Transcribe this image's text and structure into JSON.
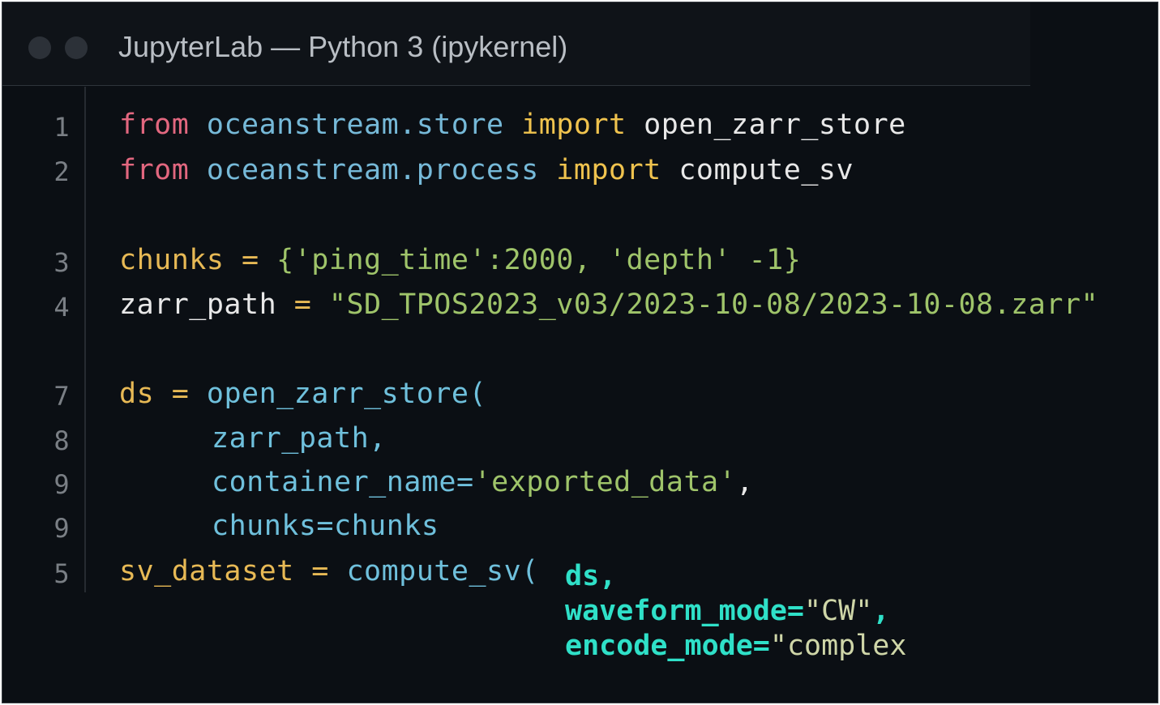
{
  "window": {
    "title": "JupyterLab — Python 3 (ipykernel)"
  },
  "lines": [
    {
      "num": "1",
      "tokens": [
        "from",
        " oceanstream.store",
        " import",
        " open_zarr_store"
      ]
    },
    {
      "num": "2",
      "tokens": [
        "from",
        " oceanstream.process",
        " import",
        " compute_sv"
      ]
    },
    {
      "num": "3",
      "tokens": [
        "chunks",
        " = ",
        "{'ping_time':2000, 'depth' -1}"
      ]
    },
    {
      "num": "4",
      "tokens": [
        "zarr_path",
        " = ",
        "\"SD_TPOS2023_v03/2023-10-08/2023-10-08.zarr\""
      ]
    },
    {
      "num": "7",
      "tokens": [
        "ds",
        " = ",
        "open_zarr_store("
      ]
    },
    {
      "num": "8",
      "tokens": [
        "zarr_path,"
      ]
    },
    {
      "num": "9",
      "tokens": [
        "container_name=",
        "'exported_data'",
        ","
      ]
    },
    {
      "num": "9",
      "tokens": [
        "chunks=chunks"
      ]
    },
    {
      "num": "5",
      "tokens": [
        "sv_dataset",
        " = ",
        "compute_sv("
      ]
    }
  ],
  "annotation": {
    "line1": "ds,",
    "line2_a": "waveform_mode=",
    "line2_b": "\"CW\"",
    "line2_c": ",",
    "line3_a": "encode_mode=",
    "line3_b": "\"complex"
  }
}
